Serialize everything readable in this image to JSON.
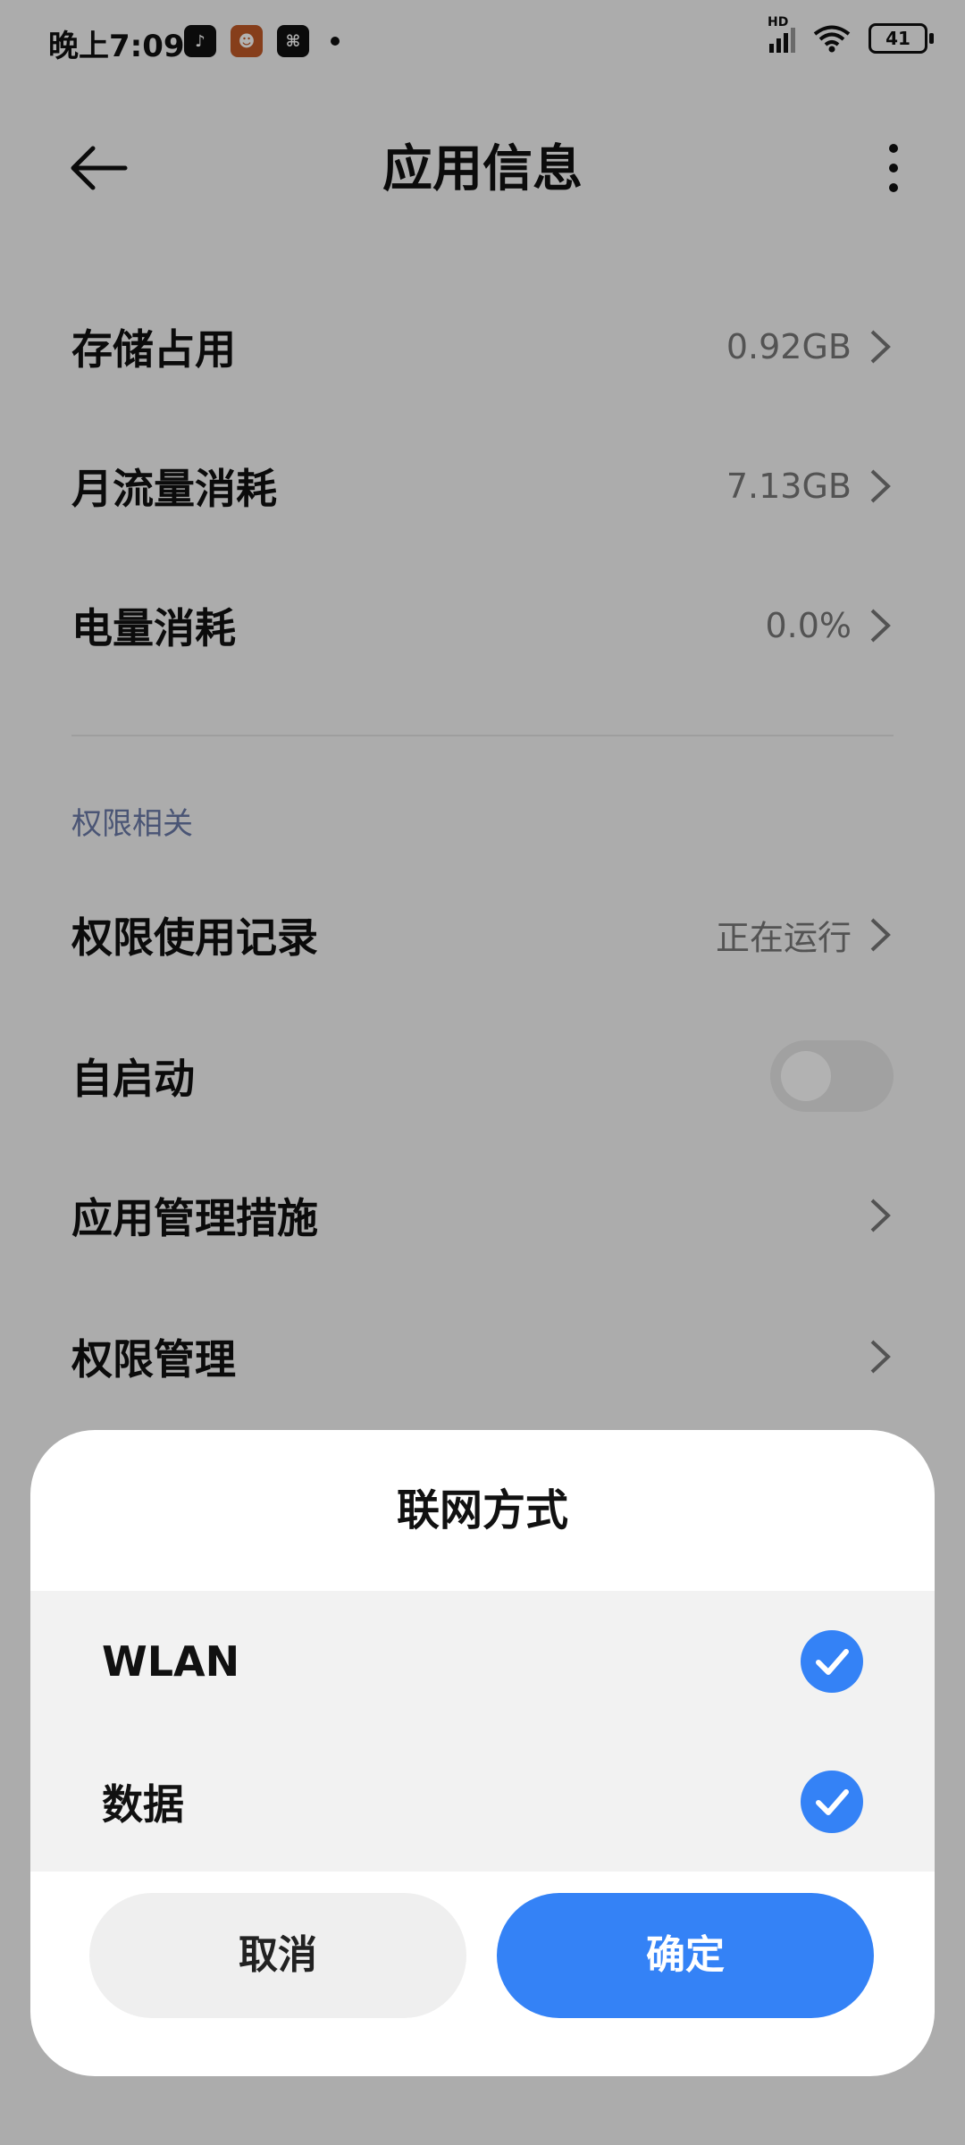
{
  "status_bar": {
    "time": "晚上7:09",
    "apps": [
      {
        "icon": "tiktok-icon",
        "glyph": "♪"
      },
      {
        "icon": "game-hero-icon",
        "glyph": "☻"
      },
      {
        "icon": "link-app-icon",
        "glyph": "⌘"
      }
    ],
    "network_label": "HD",
    "battery": "41"
  },
  "header": {
    "title": "应用信息"
  },
  "rows": [
    {
      "label": "存储占用",
      "value": "0.92GB"
    },
    {
      "label": "月流量消耗",
      "value": "7.13GB"
    },
    {
      "label": "电量消耗",
      "value": "0.0%"
    }
  ],
  "permissions": {
    "section_title": "权限相关",
    "usage_record": {
      "label": "权限使用记录",
      "value": "正在运行"
    },
    "autostart": {
      "label": "自启动",
      "enabled": false
    },
    "app_measures": {
      "label": "应用管理措施"
    },
    "permission_manage": {
      "label": "权限管理"
    }
  },
  "dialog": {
    "title": "联网方式",
    "options": [
      {
        "label": "WLAN",
        "checked": true
      },
      {
        "label": "数据",
        "checked": true
      }
    ],
    "cancel_label": "取消",
    "confirm_label": "确定"
  },
  "colors": {
    "accent": "#3482f6",
    "section": "#6b7aa8"
  }
}
